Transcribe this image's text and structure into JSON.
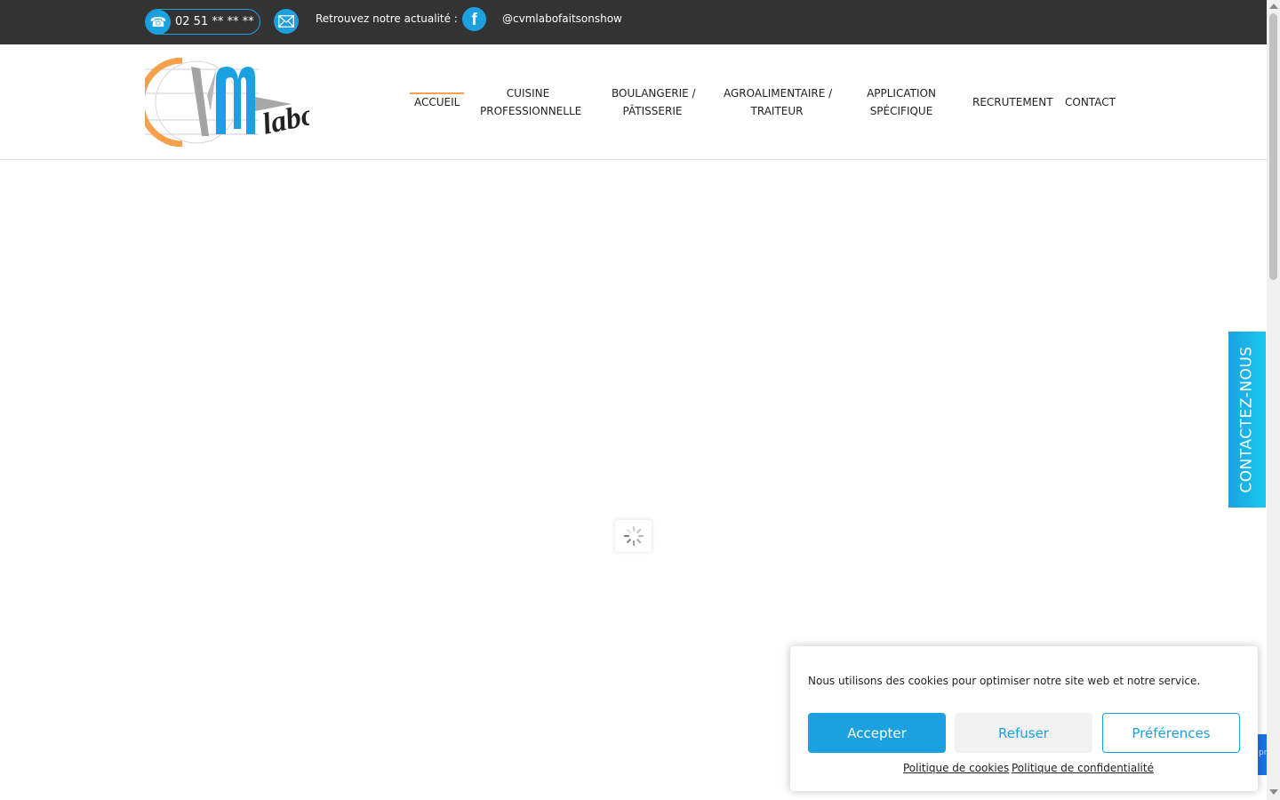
{
  "topbar": {
    "phone": "02 51 ** ** **",
    "news_label": "Retrouvez notre actualité :",
    "facebook_handle": "@cvmlabofaitsonshow",
    "icons": {
      "phone": "phone-icon",
      "mail": "mail-icon",
      "facebook": "facebook-icon"
    }
  },
  "logo": {
    "letters": "CVM",
    "word": "labo"
  },
  "nav": {
    "items": [
      {
        "label": "ACCUEIL",
        "active": true
      },
      {
        "line1": "CUISINE",
        "line2": "PROFESSIONNELLE"
      },
      {
        "line1": "BOULANGERIE /",
        "line2": "PÂTISSERIE"
      },
      {
        "line1": "AGROALIMENTAIRE /",
        "line2": "TRAITEUR"
      },
      {
        "line1": "APPLICATION",
        "line2": "SPÉCIFIQUE"
      },
      {
        "label": "RECRUTEMENT"
      },
      {
        "label": "CONTACT"
      }
    ]
  },
  "contact_tab": {
    "label": "CONTACTEZ-NOUS"
  },
  "recaptcha": {
    "text": "pr"
  },
  "cookie_banner": {
    "message": "Nous utilisons des cookies pour optimiser notre site web et notre service.",
    "accept": "Accepter",
    "deny": "Refuser",
    "preferences": "Préférences",
    "cookie_policy": "Politique de cookies",
    "privacy_policy": "Politique de confidentialité"
  },
  "colors": {
    "accent": "#1ba1df",
    "nav_active": "#f5a14b",
    "topbar_bg": "#333333",
    "logo_orange": "#f5a14b",
    "logo_grey": "#a0a0a0"
  }
}
